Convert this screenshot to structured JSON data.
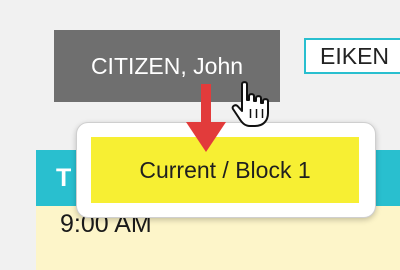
{
  "header": {
    "student_name": "CITIZEN, John",
    "next_tag": "EIKEN"
  },
  "tooltip": {
    "block_label": "Current / Block 1"
  },
  "schedule": {
    "header_text": "T",
    "time": "9:00 AM"
  },
  "colors": {
    "chip_gray": "#6f6f6f",
    "accent_teal": "#29bfcf",
    "highlight_yellow": "#f7ef33",
    "row_yellow": "#fdf5c9",
    "arrow_red": "#e23b3b"
  },
  "icons": {
    "pointer": "hand-pointer-icon",
    "annotation": "red-down-arrow-icon"
  }
}
